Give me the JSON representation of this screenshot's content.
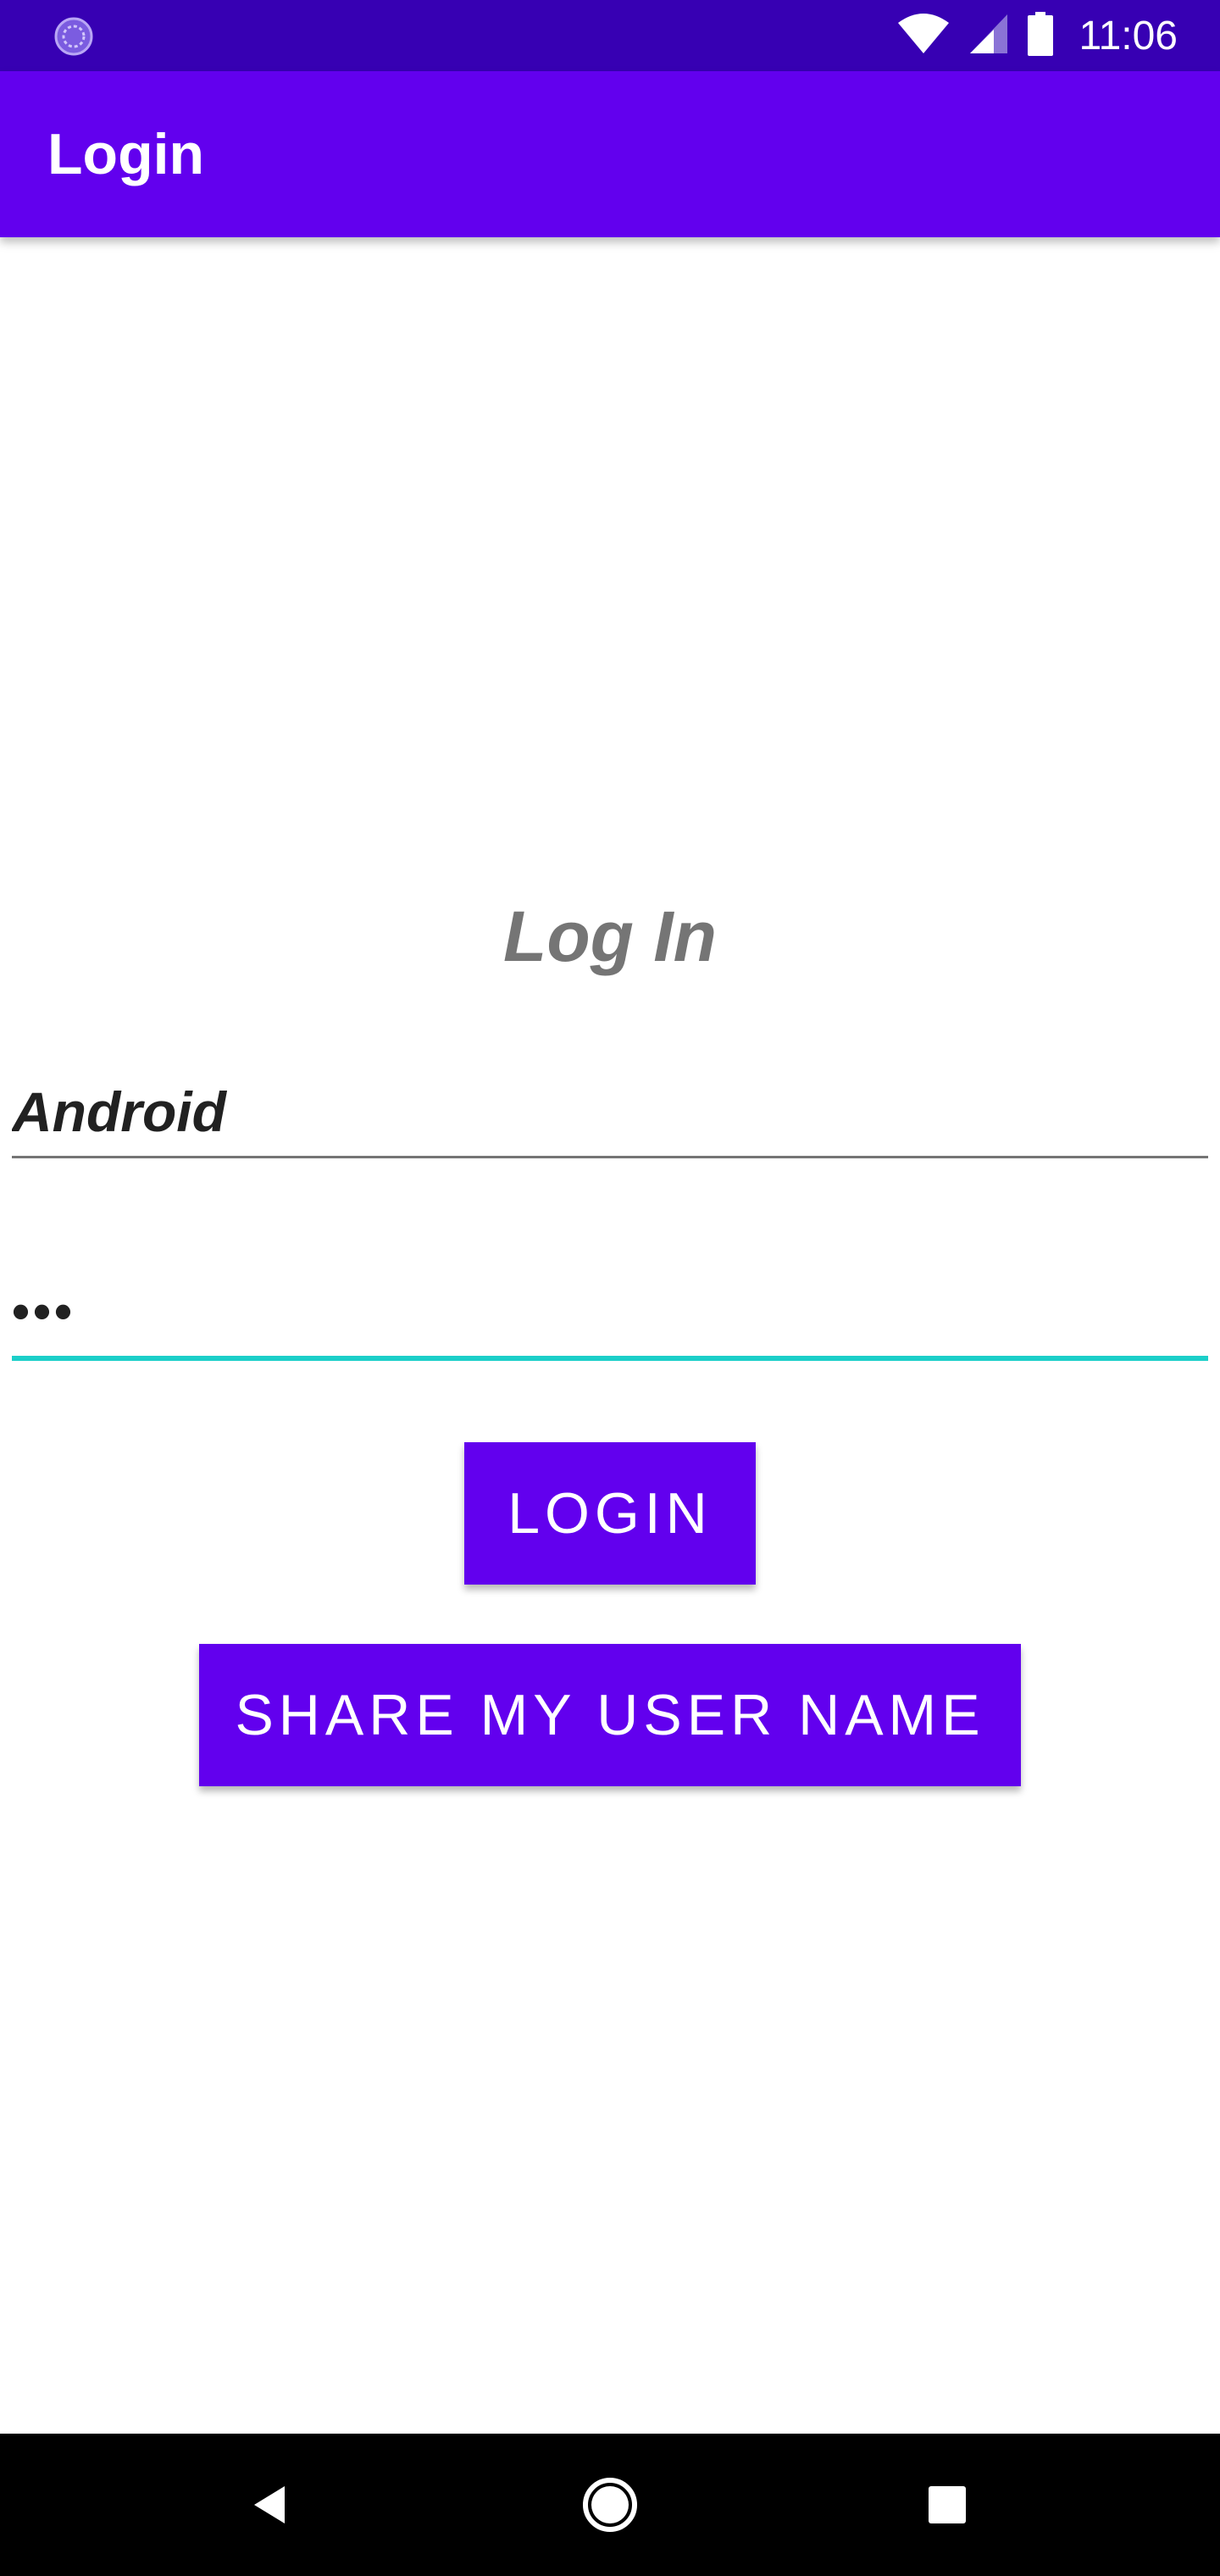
{
  "status_bar": {
    "time": "11:06",
    "icons": [
      "sync-icon",
      "wifi-icon",
      "signal-icon",
      "battery-icon"
    ],
    "background": "#3700b3"
  },
  "app_bar": {
    "title": "Login",
    "background": "#6200ee"
  },
  "main": {
    "heading": "Log In",
    "username": {
      "value": "Android"
    },
    "password": {
      "value": "•••"
    },
    "login_button_label": "LOGIN",
    "share_button_label": "SHARE MY USER NAME"
  },
  "nav_bar": {
    "icons": [
      "back-icon",
      "home-icon",
      "recents-icon"
    ]
  },
  "colors": {
    "accent": "#1ccfc9",
    "primary": "#6200ee",
    "primary_dark": "#3700b3",
    "heading_gray": "#757575"
  }
}
